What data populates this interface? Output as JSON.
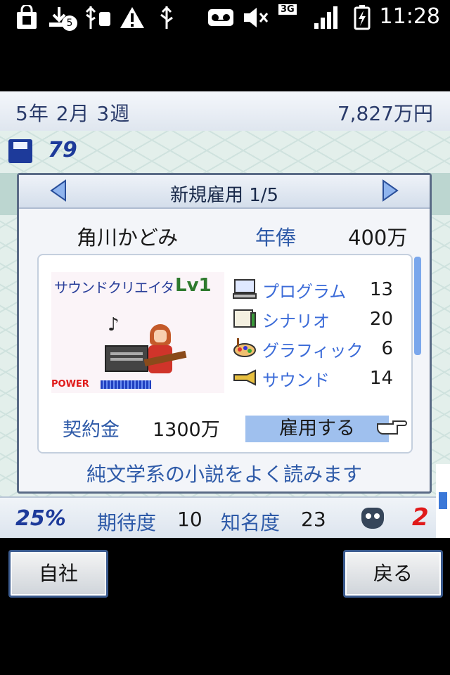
{
  "status_bar": {
    "notification_count": "5",
    "network": "3G",
    "time": "11:28",
    "icons": [
      "shopping-bag-icon",
      "download-icon",
      "usb-debug-icon",
      "warning-icon",
      "usb-icon",
      "voicemail-icon",
      "mute-icon",
      "signal-icon",
      "battery-charging-icon"
    ]
  },
  "game": {
    "date": "5年 2月 3週",
    "money": "7,827万円",
    "disk_count": "79",
    "stats": {
      "percent": "25%",
      "expectation_label": "期待度",
      "expectation_value": "10",
      "fame_label": "知名度",
      "fame_value": "23",
      "red_value": "2"
    }
  },
  "dialog": {
    "title": "新規雇用 1/5",
    "name": "角川かどみ",
    "salary_label": "年俸",
    "salary_value": "400万",
    "job_title": "サウンドクリエイタ",
    "level": "Lv1",
    "power_label": "POWER",
    "skills": [
      {
        "label": "プログラム",
        "value": "13",
        "icon": "computer-icon"
      },
      {
        "label": "シナリオ",
        "value": "20",
        "icon": "book-icon"
      },
      {
        "label": "グラフィック",
        "value": "6",
        "icon": "palette-icon"
      },
      {
        "label": "サウンド",
        "value": "14",
        "icon": "trumpet-icon"
      }
    ],
    "contract_label": "契約金",
    "contract_value": "1300万",
    "hire_label": "雇用する",
    "description": "純文学系の小説をよく読みます"
  },
  "buttons": {
    "left": "自社",
    "right": "戻る"
  },
  "colors": {
    "accent_blue": "#2e5aa8",
    "hire_highlight": "#9fc0ee",
    "alert_red": "#e01a1a"
  }
}
